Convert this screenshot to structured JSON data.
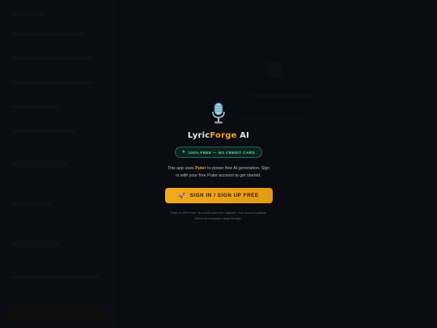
{
  "modal": {
    "title_prefix": "Lyric",
    "title_accent": "Forge",
    "title_suffix": " AI",
    "badge_icon": "✦",
    "badge_text": "100% FREE — NO CREDIT CARD",
    "desc_before": "This app uses ",
    "desc_brand": "Puter",
    "desc_after": " to power free AI generation. Sign in with your free Puter account to get started.",
    "signin_icon": "🚀",
    "signin_label": "SIGN IN / SIGN UP FREE",
    "note": "Puter is 100% free. No credit card ever required. Your account powers the AI for everyone using this app."
  },
  "icons": {
    "microphone": "microphone-icon",
    "rocket": "rocket-icon",
    "sparkle": "sparkle-icon"
  },
  "colors": {
    "accent": "#f5a623",
    "badge_green": "#5fe0ad",
    "background": "#0d0d15"
  }
}
